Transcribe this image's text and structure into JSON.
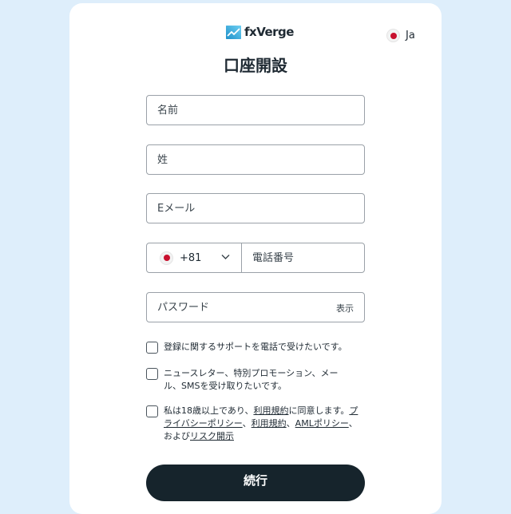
{
  "header": {
    "brand": "fxVerge",
    "language": "Ja",
    "title": "口座開設"
  },
  "form": {
    "first_name_placeholder": "名前",
    "last_name_placeholder": "姓",
    "email_placeholder": "Eメール",
    "phone": {
      "country_code": "+81",
      "placeholder": "電話番号"
    },
    "password_placeholder": "パスワード",
    "show_label": "表示"
  },
  "consents": {
    "phone_support": "登録に関するサポートを電話で受けたいです。",
    "newsletter": "ニュースレター、特別プロモーション、メール、SMSを受け取りたいです。",
    "terms": {
      "prefix": "私は18歳以上であり、",
      "link_terms": "利用規約",
      "mid1": "に同意します。",
      "link_privacy": "プライバシーポリシー",
      "sep1": "、",
      "link_terms2": "利用規約",
      "sep2": "、",
      "link_aml": "AMLポリシー",
      "mid2": "、および",
      "link_risk": "リスク開示"
    }
  },
  "submit_label": "続行",
  "colors": {
    "background": "#deeefb",
    "button": "#16242c",
    "flag_red": "#c8102e",
    "logo_accent": "#2aa4d8"
  }
}
